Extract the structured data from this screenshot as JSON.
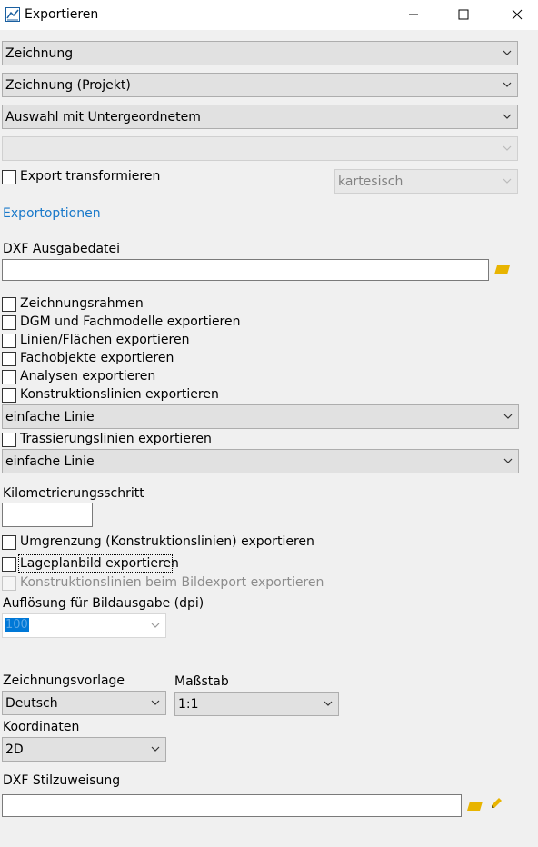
{
  "window": {
    "title": "Exportieren",
    "icon": "chart-line-icon",
    "buttons": [
      "minimize-icon",
      "maximize-icon",
      "close-icon"
    ]
  },
  "selectors": {
    "type": "Zeichnung",
    "scope": "Zeichnung (Projekt)",
    "selection": "Auswahl mit Untergeordnetem",
    "empty": ""
  },
  "transform": {
    "label": "Export transformieren",
    "checked": false,
    "coord_system": "kartesisch"
  },
  "export_options_link": "Exportoptionen",
  "dxf_output": {
    "label": "DXF Ausgabedatei",
    "value": "",
    "browse_icon": "folder-icon"
  },
  "options": [
    {
      "label": "Zeichnungsrahmen",
      "checked": false
    },
    {
      "label": "DGM und Fachmodelle exportieren",
      "checked": false
    },
    {
      "label": "Linien/Flächen exportieren",
      "checked": false
    },
    {
      "label": "Fachobjekte exportieren",
      "checked": false
    },
    {
      "label": "Analysen exportieren",
      "checked": false
    },
    {
      "label": "Konstruktionslinien exportieren",
      "checked": false
    }
  ],
  "construction_line_style": "einfache Linie",
  "alignment": {
    "label": "Trassierungslinien exportieren",
    "checked": false,
    "line_style": "einfache Linie"
  },
  "km_step": {
    "label": "Kilometrierungsschritt",
    "value": ""
  },
  "boundary": {
    "label": "Umgrenzung (Konstruktionslinien) exportieren",
    "checked": false
  },
  "site_plan": {
    "label": "Lageplanbild exportieren",
    "checked": false
  },
  "construction_image": {
    "label": "Konstruktionslinien beim Bildexport exportieren",
    "checked": false,
    "disabled": true
  },
  "resolution": {
    "label": "Auflösung für Bildausgabe (dpi)",
    "value": "100"
  },
  "drawing_template": {
    "label": "Zeichnungsvorlage",
    "value": "Deutsch"
  },
  "scale": {
    "label": "Maßstab",
    "value": "1:1"
  },
  "coordinates": {
    "label": "Koordinaten",
    "value": "2D"
  },
  "dxf_style": {
    "label": "DXF Stilzuweisung",
    "value": "",
    "browse_icon": "folder-icon",
    "edit_icon": "pencil-icon"
  },
  "colors": {
    "link": "#1979ca",
    "folder": "#e8b400",
    "selection": "#0078d7"
  }
}
